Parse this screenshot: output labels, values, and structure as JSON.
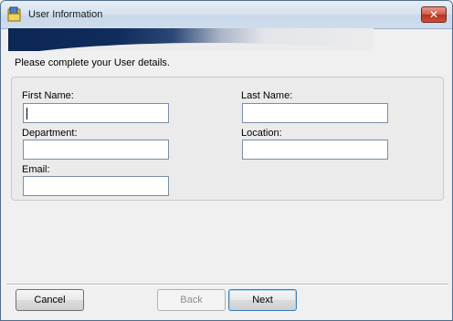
{
  "window": {
    "title": "User Information",
    "close_glyph": "✕",
    "icon": "app-folder-icon"
  },
  "instruction": "Please complete your User details.",
  "form": {
    "first_name_label": "First Name:",
    "last_name_label": "Last Name:",
    "department_label": "Department:",
    "location_label": "Location:",
    "email_label": "Email:",
    "first_name_value": "",
    "last_name_value": "",
    "department_value": "",
    "location_value": "",
    "email_value": ""
  },
  "buttons": {
    "cancel": "Cancel",
    "back": "Back",
    "next": "Next"
  },
  "colors": {
    "banner_dark": "#0c2754",
    "close_red": "#c8503a",
    "default_button_border": "#3c7fb1"
  }
}
